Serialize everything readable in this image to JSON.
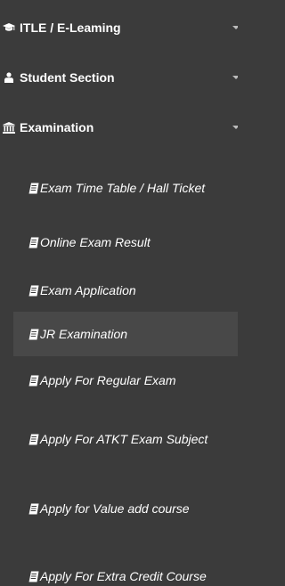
{
  "menu": {
    "top": [
      {
        "label": "ITLE / E-Leaming",
        "icon": "graduation-cap-icon"
      },
      {
        "label": "Student Section",
        "icon": "user-icon"
      },
      {
        "label": "Examination",
        "icon": "bank-icon"
      }
    ],
    "sub": [
      {
        "label": "Exam Time Table / Hall Ticket",
        "icon": "document-icon"
      },
      {
        "label": "Online Exam Result",
        "icon": "document-icon"
      },
      {
        "label": "Exam Application",
        "icon": "document-icon"
      },
      {
        "label": "JR Examination",
        "icon": "document-icon",
        "active": true
      },
      {
        "label": "Apply For Regular Exam",
        "icon": "document-icon"
      },
      {
        "label": "Apply For ATKT Exam Subject",
        "icon": "document-icon"
      },
      {
        "label": "Apply for Value add course",
        "icon": "document-icon"
      },
      {
        "label": "Apply For Extra Credit Course",
        "icon": "document-icon"
      }
    ]
  },
  "colors": {
    "background": "#3b3b3b",
    "active_background": "#484848",
    "text": "#ffffff"
  }
}
